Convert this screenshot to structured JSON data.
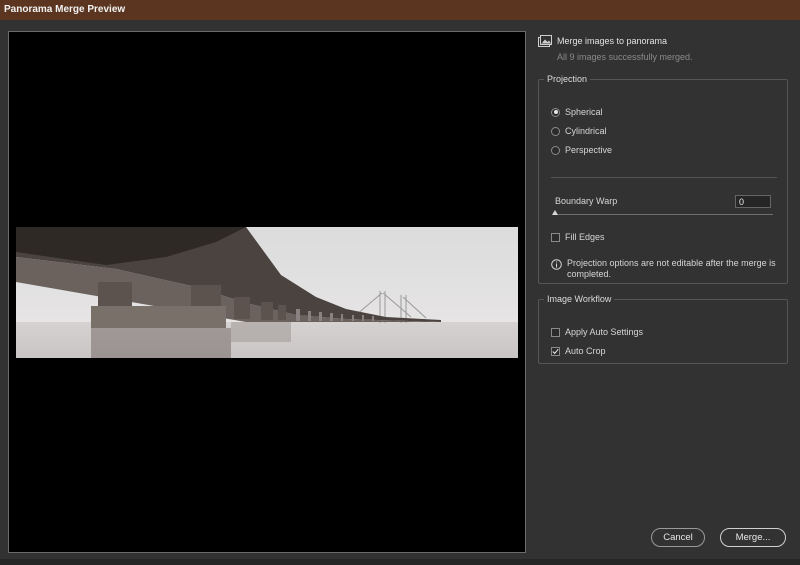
{
  "window": {
    "title": "Panorama Merge Preview"
  },
  "header": {
    "icon": "panorama-icon",
    "title": "Merge images to panorama",
    "status": "All 9 images successfully merged."
  },
  "projection": {
    "legend": "Projection",
    "options": [
      {
        "label": "Spherical",
        "selected": true
      },
      {
        "label": "Cylindrical",
        "selected": false
      },
      {
        "label": "Perspective",
        "selected": false
      }
    ],
    "boundary_warp": {
      "label": "Boundary Warp",
      "value": "0",
      "level": 0
    },
    "fill_edges": {
      "label": "Fill Edges",
      "checked": false
    },
    "info": "Projection options are not editable after the merge is completed."
  },
  "workflow": {
    "legend": "Image Workflow",
    "apply_auto_settings": {
      "label": "Apply Auto Settings",
      "checked": false
    },
    "auto_crop": {
      "label": "Auto Crop",
      "checked": true
    }
  },
  "buttons": {
    "cancel": "Cancel",
    "merge": "Merge..."
  },
  "colors": {
    "titlebar": "#5b3520",
    "panel": "#323232",
    "preview_bg": "#000000"
  }
}
